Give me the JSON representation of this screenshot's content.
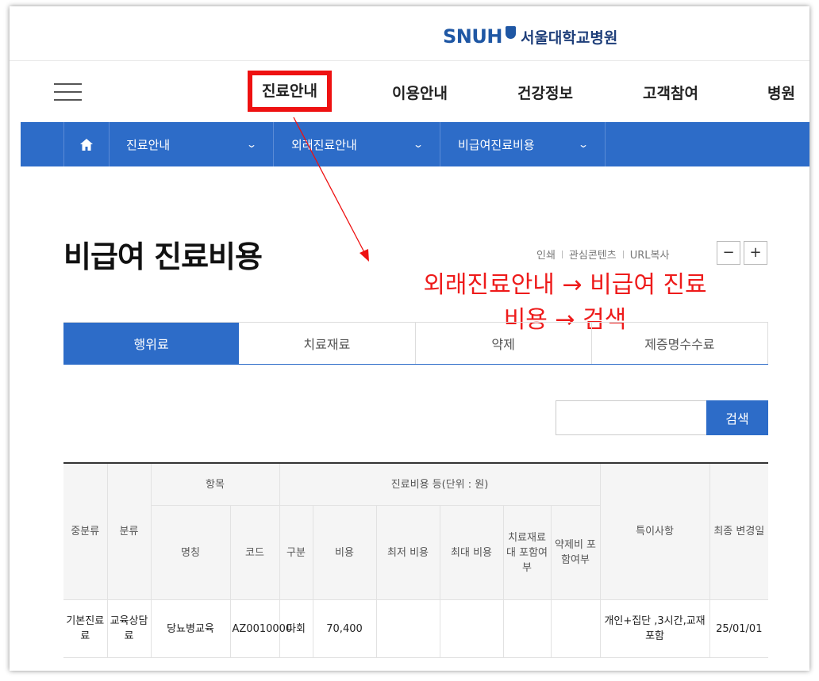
{
  "header": {
    "logo_en": "SNUH",
    "logo_kr": "서울대학교병원"
  },
  "gnb": {
    "items": [
      "진료안내",
      "이용안내",
      "건강정보",
      "고객참여",
      "병원"
    ]
  },
  "breadcrumb": {
    "items": [
      "진료안내",
      "외래진료안내",
      "비급여진료비용"
    ]
  },
  "page": {
    "title": "비급여 진료비용",
    "utils": [
      "인쇄",
      "관심콘텐츠",
      "URL복사"
    ],
    "zoom_out": "−",
    "zoom_in": "+"
  },
  "annotation": {
    "line1": "외래진료안내 → 비급여 진료",
    "line2": "비용 → 검색",
    "color": "#ee1b1b"
  },
  "tabs": [
    "행위료",
    "치료재료",
    "약제",
    "제증명수수료"
  ],
  "search": {
    "value": "",
    "button_label": "검색"
  },
  "table": {
    "headers": {
      "mid_category": "중분류",
      "category": "분류",
      "item_group": "항목",
      "cost_group": "진료비용 등(단위 : 원)",
      "notes": "특이사항",
      "updated": "최종 변경일",
      "name": "명칭",
      "code": "코드",
      "type": "구분",
      "cost": "비용",
      "min_cost": "최저 비용",
      "max_cost": "최대 비용",
      "material_included": "치료재료대 포함여부",
      "drug_included": "약제비 포함여부"
    },
    "rows": [
      {
        "mid_category": "기본진료료",
        "category": "교육상담료",
        "name": "당뇨병교육",
        "code": "AZ0010000",
        "type": "다회",
        "cost": "70,400",
        "min_cost": "",
        "max_cost": "",
        "material_included": "",
        "drug_included": "",
        "notes": "개인+집단 ,3시간,교재포함",
        "updated": "25/01/01"
      }
    ]
  },
  "colors": {
    "brand_blue": "#2d6cc8",
    "highlight_red": "#ee1111"
  }
}
